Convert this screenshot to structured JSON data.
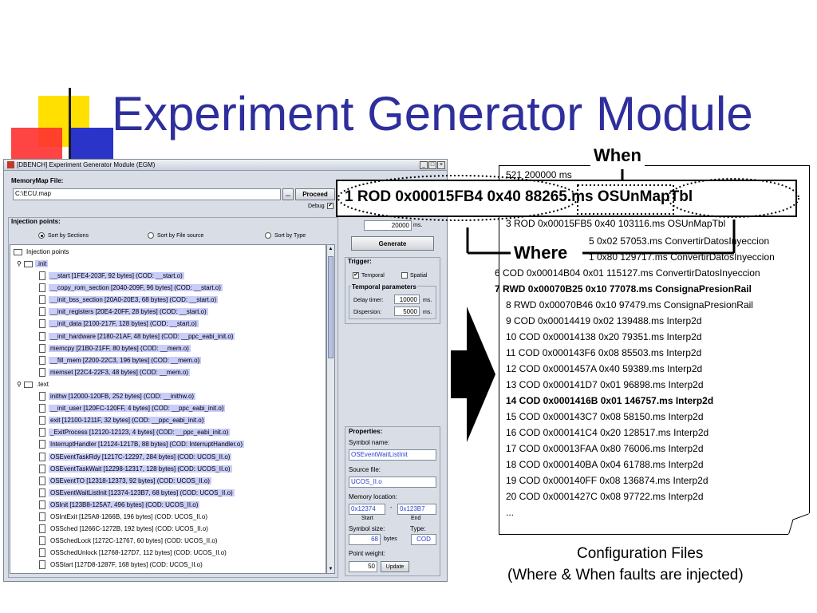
{
  "slide": {
    "title": "Experiment Generator Module",
    "caption_line1": "Configuration Files",
    "caption_line2": "(Where & When faults are injected)",
    "callout_when": "When",
    "callout_where": "Where"
  },
  "window": {
    "title": "[DBENCH]  Experiment Generator Module (EGM)",
    "memorymap_label": "MemoryMap File:",
    "memorymap_value": "C:\\ECU.map",
    "browse_label": "...",
    "proceed_label": "Proceed",
    "debug_label": "Debug",
    "injection_points_label": "Injection points:",
    "sort_options": [
      "Sort by Sections",
      "Sort by File source",
      "Sort by Type"
    ],
    "timeout_value": "20000",
    "timeout_unit": "ms.",
    "generate_label": "Generate",
    "trigger_label": "Trigger:",
    "temporal_label": "Temporal",
    "spatial_label": "Spatial",
    "temporal_params_label": "Temporal parameters",
    "delay_timer_label": "Delay timer:",
    "delay_timer_value": "10000",
    "dispersion_label": "Dispersion:",
    "dispersion_value": "5000",
    "ms_unit": "ms.",
    "properties_label": "Properties:",
    "symbol_name_label": "Symbol name:",
    "symbol_name_value": "OSEventWaitListInit",
    "source_file_label": "Source file:",
    "source_file_value": "UCOS_II.o",
    "memory_location_label": "Memory location:",
    "mem_start_value": "0x12374",
    "mem_dash": "-",
    "mem_end_value": "0x123B7",
    "start_label": "Start",
    "end_label": "End",
    "symbol_size_label": "Symbol size:",
    "type_label": "Type:",
    "size_value": "68",
    "bytes_label": "bytes",
    "type_value": "COD",
    "point_weight_label": "Point weight:",
    "weight_value": "50",
    "update_label": "Update"
  },
  "tree": {
    "root": "Injection points",
    "sections": [
      {
        "name": ".init",
        "items": [
          {
            "label": "__start     [1FE4-203F, 92 bytes] (COD: __start.o)",
            "sel": true
          },
          {
            "label": "__copy_rom_section     [2040-209F, 96 bytes] (COD: __start.o)",
            "sel": true
          },
          {
            "label": "__init_bss_section     [20A0-20E3, 68 bytes] (COD: __start.o)",
            "sel": true
          },
          {
            "label": "__init_registers     [20E4-20FF, 28 bytes] (COD: __start.o)",
            "sel": true
          },
          {
            "label": "__init_data     [2100-217F, 128 bytes] (COD: __start.o)",
            "sel": true
          },
          {
            "label": "__init_hardware     [2180-21AF, 48 bytes] (COD: __ppc_eabi_init.o)",
            "sel": true
          },
          {
            "label": "memcpy     [21B0-21FF, 80 bytes] (COD: __mem.o)",
            "sel": true
          },
          {
            "label": "__fill_mem     [2200-22C3, 196 bytes] (COD: __mem.o)",
            "sel": true
          },
          {
            "label": "memset     [22C4-22F3, 48 bytes] (COD: __mem.o)",
            "sel": true
          }
        ]
      },
      {
        "name": ".text",
        "items": [
          {
            "label": "inithw     [12000-120FB, 252 bytes] (COD: __inithw.o)",
            "sel": true
          },
          {
            "label": "__init_user     [120FC-120FF, 4 bytes] (COD: __ppc_eabi_init.o)",
            "sel": true
          },
          {
            "label": "exit     [12100-1211F, 32 bytes] (COD: __ppc_eabi_init.o)",
            "sel": true
          },
          {
            "label": "_ExitProcess     [12120-12123, 4 bytes] (COD: __ppc_eabi_init.o)",
            "sel": true
          },
          {
            "label": "InterruptHandler     [12124-1217B, 88 bytes] (COD: InterruptHandler.o)",
            "sel": true
          },
          {
            "label": "OSEventTaskRdy     [1217C-12297, 284 bytes] (COD: UCOS_II.o)",
            "sel": true
          },
          {
            "label": "OSEventTaskWait     [12298-12317, 128 bytes] (COD: UCOS_II.o)",
            "sel": true
          },
          {
            "label": "OSEventTO     [12318-12373, 92 bytes] (COD: UCOS_II.o)",
            "sel": true
          },
          {
            "label": "OSEventWaitListInit     [12374-123B7, 68 bytes] (COD: UCOS_II.o)",
            "sel": true
          },
          {
            "label": "OSInit     [123B8-125A7, 496 bytes] (COD: UCOS_II.o)",
            "sel": true
          },
          {
            "label": "OSIntExit     [125A8-1266B, 196 bytes] (COD: UCOS_II.o)",
            "sel": false
          },
          {
            "label": "OSSched     [1266C-1272B, 192 bytes] (COD: UCOS_II.o)",
            "sel": false
          },
          {
            "label": "OSSchedLock     [1272C-12767, 60 bytes] (COD: UCOS_II.o)",
            "sel": false
          },
          {
            "label": "OSSchedUnlock     [12768-127D7, 112 bytes] (COD: UCOS_II.o)",
            "sel": false
          },
          {
            "label": "OSStart     [127D8-1287F, 168 bytes] (COD: UCOS_II.o)",
            "sel": false
          }
        ]
      }
    ]
  },
  "config": {
    "header_partial": "521 200000 ms",
    "highlight": "1 ROD 0x00015FB4 0x40 88265.ms OSUnMapTbl",
    "lines": [
      {
        "text": "3 ROD 0x00015FB5 0x40 103116.ms OSUnMapTbl",
        "bold": false
      },
      {
        "text": "5 0x02 57053.ms ConvertirDatosInyeccion",
        "bold": false
      },
      {
        "text": "1 0x80 129717.ms ConvertirDatosInyeccion",
        "bold": false
      },
      {
        "text": "6 COD 0x00014B04 0x01 115127.ms ConvertirDatosInyeccion",
        "bold": false
      },
      {
        "text": "7 RWD 0x00070B25 0x10 77078.ms ConsignaPresionRail",
        "bold": true
      },
      {
        "text": "8 RWD 0x00070B46 0x10 97479.ms ConsignaPresionRail",
        "bold": false
      },
      {
        "text": "9 COD 0x00014419 0x02 139488.ms Interp2d",
        "bold": false
      },
      {
        "text": "10 COD 0x00014138 0x20 79351.ms Interp2d",
        "bold": false
      },
      {
        "text": "11 COD 0x000143F6 0x08 85503.ms Interp2d",
        "bold": false
      },
      {
        "text": "12 COD 0x0001457A 0x40 59389.ms Interp2d",
        "bold": false
      },
      {
        "text": "13 COD 0x000141D7 0x01 96898.ms Interp2d",
        "bold": false
      },
      {
        "text": "14 COD 0x0001416B 0x01 146757.ms Interp2d",
        "bold": true
      },
      {
        "text": "15 COD 0x000143C7 0x08 58150.ms Interp2d",
        "bold": false
      },
      {
        "text": "16 COD 0x000141C4 0x20 128517.ms Interp2d",
        "bold": false
      },
      {
        "text": "17 COD 0x00013FAA 0x80 76006.ms Interp2d",
        "bold": false
      },
      {
        "text": "18 COD 0x000140BA 0x04 61788.ms Interp2d",
        "bold": false
      },
      {
        "text": "19 COD 0x000140FF 0x08 136874.ms Interp2d",
        "bold": false
      },
      {
        "text": "20 COD 0x0001427C 0x08 97722.ms Interp2d",
        "bold": false
      },
      {
        "text": "...",
        "bold": false
      }
    ]
  }
}
